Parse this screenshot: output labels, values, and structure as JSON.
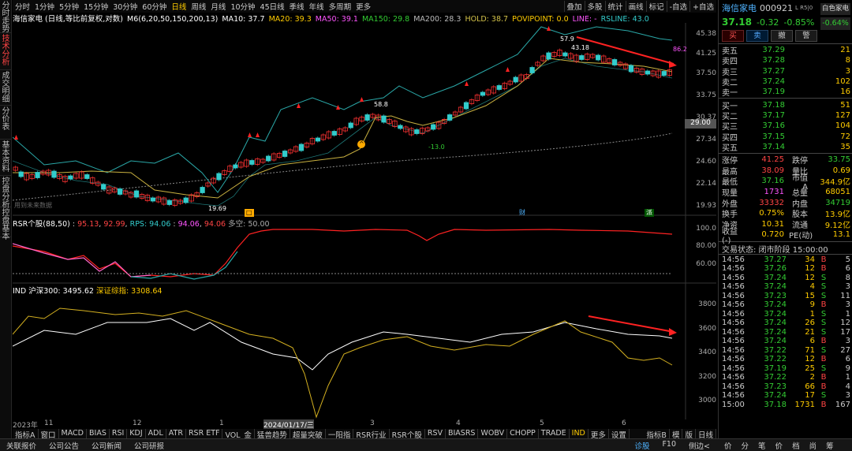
{
  "left_tabs": [
    "分时走势",
    "技术分析",
    "成交明细",
    "分价表",
    "基本资料",
    "控盘分析",
    "控盘基本"
  ],
  "period_tabs": [
    "分时",
    "1分钟",
    "5分钟",
    "15分钟",
    "30分钟",
    "60分钟",
    "日线",
    "周线",
    "月线",
    "10分钟",
    "45日线",
    "季线",
    "年线",
    "多周期",
    "更多"
  ],
  "right_tools": [
    "叠加",
    "多股",
    "统计",
    "画线",
    "标记",
    "-自选",
    "+自选"
  ],
  "ma_line": {
    "name": "海信家电 (日线,等比前复权,对数)",
    "m6": "M6(6,20,50,150,200,13)",
    "ma10": "MA10: 37.7",
    "ma20": "MA20: 39.3",
    "ma50": "MA50: 39.1",
    "ma150": "MA150: 29.8",
    "ma200": "MA200: 28.3",
    "hold": "HOLD: 38.7",
    "povi": "POVIPOINT: 0.0",
    "line": "LINE: -",
    "rsline": "RSLINE: 43.0"
  },
  "price_axis": [
    "45.38",
    "41.25",
    "37.50",
    "33.75",
    "30.37",
    "27.34",
    "24.60",
    "22.14",
    "19.93"
  ],
  "price_marker": "29.00",
  "annotations": {
    "hi": "57.9",
    "hi2": "43.18",
    "mid": "58.8",
    "low": "-13.0",
    "low2": "19.69",
    "r": "86.2"
  },
  "caption_future": "用到未来数据",
  "sub1_label": {
    "name": "RSR个股(88,50)",
    "v1": "95.13",
    "v2": "92.99",
    "rps": "RPS: 94.06",
    "v3": "94.06",
    "v4": "94.06",
    "dk": "多空: 50.00"
  },
  "sub1_axis": [
    "100.0",
    "80.00",
    "60.00"
  ],
  "sub2_label": {
    "name": "IND",
    "hs": "沪深300: 3495.62",
    "sz": "深证综指: 3308.64"
  },
  "sub2_axis": [
    "3800",
    "3600",
    "3400",
    "3200",
    "3000"
  ],
  "x_axis": [
    "2023年",
    "11",
    "12",
    "1",
    "2024/01/17/三",
    "3",
    "4",
    "5",
    "6"
  ],
  "bottom_tabs": [
    "指标A",
    "窗口",
    "MACD",
    "BIAS",
    "RSI",
    "KDJ",
    "ADL",
    "ATR",
    "RSR ETF",
    "VOL_金",
    "猛兽趋势",
    "超量突破",
    "一阳指",
    "RSR行业",
    "RSR个股",
    "RSV",
    "BIASRS",
    "WOBV",
    "CHOPP",
    "TRADE",
    "IND",
    "更多",
    "设置"
  ],
  "bottom_right": [
    "指标B",
    "模",
    "版",
    "日线"
  ],
  "status_bar": [
    "关联报价",
    "公司公告",
    "公司新闻",
    "公司研报"
  ],
  "status_right": [
    "诊股",
    "F10",
    "侧边<"
  ],
  "status_tabs": [
    "价",
    "分",
    "笔",
    "价",
    "档",
    "尚",
    "筹"
  ],
  "stock": {
    "name": "海信家电",
    "code": "000921",
    "level": "L R5|0",
    "color_btn": "白色家电",
    "price": "37.18",
    "chg": "-0.32",
    "pct": "-0.85%",
    "pct_btn": "-0.64%"
  },
  "trade_btns": [
    "买",
    "卖",
    "撤",
    "警"
  ],
  "asks": [
    [
      "卖五",
      "37.29",
      "21"
    ],
    [
      "卖四",
      "37.28",
      "8"
    ],
    [
      "卖三",
      "37.27",
      "3"
    ],
    [
      "卖二",
      "37.24",
      "102"
    ],
    [
      "卖一",
      "37.19",
      "16"
    ]
  ],
  "bids": [
    [
      "买一",
      "37.18",
      "51"
    ],
    [
      "买二",
      "37.17",
      "127"
    ],
    [
      "买三",
      "37.16",
      "104"
    ],
    [
      "买四",
      "37.15",
      "72"
    ],
    [
      "买五",
      "37.14",
      "35"
    ]
  ],
  "stats": [
    [
      "涨停",
      "41.25",
      "跌停",
      "33.75"
    ],
    [
      "最高",
      "38.09",
      "量比",
      "0.69"
    ],
    [
      "最低",
      "37.16",
      "市值A",
      "344.9亿"
    ],
    [
      "现量",
      "1731",
      "总量",
      "68051"
    ],
    [
      "外盘",
      "33332",
      "内盘",
      "34719"
    ],
    [
      "换手",
      "0.75%",
      "股本",
      "13.9亿"
    ],
    [
      "净资",
      "10.31",
      "流通",
      "9.12亿"
    ],
    [
      "收益(-)",
      "0.720",
      "PE(动)",
      "13.1"
    ]
  ],
  "trade_status": "交易状态: 闭市阶段 15:00:00",
  "trades": [
    [
      "14:56",
      "37.27",
      "34",
      "B",
      "5"
    ],
    [
      "14:56",
      "37.26",
      "12",
      "B",
      "6"
    ],
    [
      "14:56",
      "37.24",
      "12",
      "S",
      "8"
    ],
    [
      "14:56",
      "37.24",
      "4",
      "S",
      "3"
    ],
    [
      "14:56",
      "37.23",
      "15",
      "S",
      "11"
    ],
    [
      "14:56",
      "37.24",
      "9",
      "B",
      "3"
    ],
    [
      "14:56",
      "37.24",
      "1",
      "S",
      "1"
    ],
    [
      "14:56",
      "37.24",
      "26",
      "S",
      "12"
    ],
    [
      "14:56",
      "37.24",
      "21",
      "S",
      "17"
    ],
    [
      "14:56",
      "37.24",
      "6",
      "B",
      "3"
    ],
    [
      "14:56",
      "37.22",
      "71",
      "S",
      "27"
    ],
    [
      "14:56",
      "37.22",
      "12",
      "B",
      "6"
    ],
    [
      "14:56",
      "37.19",
      "25",
      "S",
      "9"
    ],
    [
      "14:56",
      "37.22",
      "2",
      "B",
      "1"
    ],
    [
      "14:56",
      "37.23",
      "66",
      "B",
      "4"
    ],
    [
      "14:56",
      "37.24",
      "17",
      "S",
      "3"
    ],
    [
      "15:00",
      "37.18",
      "1731",
      "B",
      "167"
    ]
  ]
}
